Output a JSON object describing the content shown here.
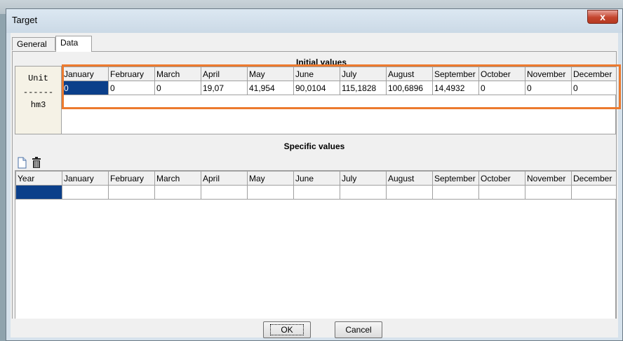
{
  "window": {
    "title": "Target",
    "close_label": "x"
  },
  "tabs": [
    {
      "label": "General"
    },
    {
      "label": "Data"
    }
  ],
  "initial": {
    "title": "Initial values",
    "unit_header": "Unit",
    "unit_separator": "------",
    "unit_value": "hm3",
    "months": [
      "January",
      "February",
      "March",
      "April",
      "May",
      "June",
      "July",
      "August",
      "September",
      "October",
      "November",
      "December"
    ],
    "values": [
      "0",
      "0",
      "0",
      "19,07",
      "41,954",
      "90,0104",
      "115,1828",
      "100,6896",
      "14,4932",
      "0",
      "0",
      "0"
    ]
  },
  "specific": {
    "title": "Specific values",
    "year_header": "Year",
    "months": [
      "January",
      "February",
      "March",
      "April",
      "May",
      "June",
      "July",
      "August",
      "September",
      "October",
      "November",
      "December"
    ]
  },
  "buttons": {
    "ok": "OK",
    "cancel": "Cancel"
  },
  "icons": {
    "new": "new-document-icon",
    "delete": "trash-icon"
  },
  "colors": {
    "selection": "#0b3f8a",
    "highlight": "#ec7a2e"
  }
}
